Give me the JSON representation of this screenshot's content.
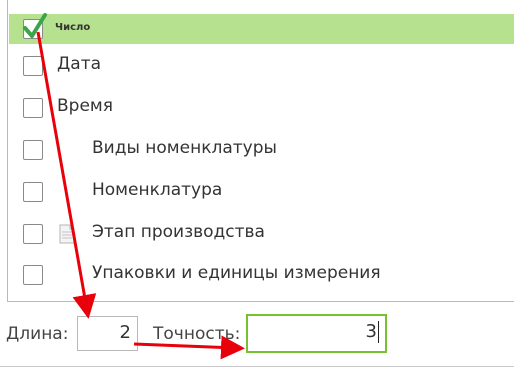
{
  "list": {
    "items": [
      {
        "label": "Число",
        "checked": true,
        "selected": true
      },
      {
        "label": "Дата",
        "checked": false
      },
      {
        "label": "Время",
        "checked": false
      },
      {
        "label": "Виды номенклатуры",
        "checked": false
      },
      {
        "label": "Номенклатура",
        "checked": false
      },
      {
        "label": "Этап производства",
        "checked": false,
        "icon": "document-icon"
      },
      {
        "label": "Упаковки и единицы измерения",
        "checked": false
      }
    ]
  },
  "precision": {
    "length_label": "Длина:",
    "length_value": "2",
    "accuracy_label": "Точность:",
    "accuracy_value": "3"
  },
  "colors": {
    "selected_row": "#b6e18e",
    "checkmark": "#3aa54a",
    "focus_border": "#77c031",
    "annotation_arrow": "#e8000b"
  }
}
